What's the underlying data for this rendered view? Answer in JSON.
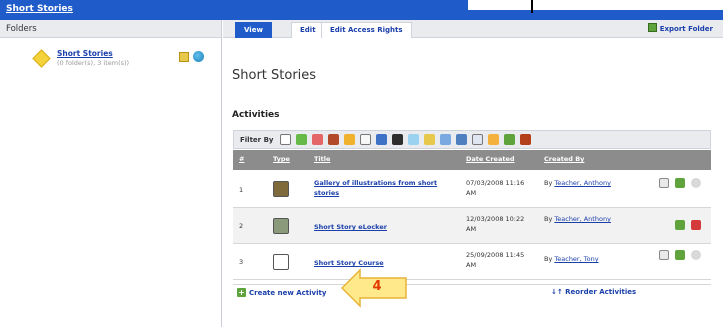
{
  "app": {
    "title": "Short Stories"
  },
  "left": {
    "header": "Folders",
    "folder": {
      "name": "Short Stories",
      "meta": "(0 folder(s), 3 item(s))"
    }
  },
  "tabs": [
    {
      "label": "View"
    },
    {
      "label": "Edit"
    },
    {
      "label": "Edit Access Rights"
    }
  ],
  "export_label": "Export Folder",
  "main": {
    "page_title": "Short Stories",
    "section_title": "Activities",
    "filter_label": "Filter By"
  },
  "table": {
    "headers": [
      "#",
      "Type",
      "Title",
      "Date Created",
      "Created By"
    ],
    "rows": [
      {
        "num": "1",
        "title": "Gallery of illustrations from short stories",
        "date": "07/03/2008 11:16 AM",
        "by_prefix": "By",
        "by_name": "Teacher, Anthony",
        "type_icon": "gallery-icon"
      },
      {
        "num": "2",
        "title": "Short Story eLocker",
        "date": "12/03/2008 10:22 AM",
        "by_prefix": "By",
        "by_name": "Teacher, Anthony",
        "type_icon": "elocker-icon"
      },
      {
        "num": "3",
        "title": "Short Story Course",
        "date": "25/09/2008 11:45 AM",
        "by_prefix": "By",
        "by_name": "Teacher, Tony",
        "type_icon": "course-icon"
      }
    ]
  },
  "footer": {
    "create_label": "Create new Activity",
    "reorder_label": "Reorder Activities"
  },
  "callout": {
    "number": "4"
  },
  "colors": {
    "brand": "#1f5bc9",
    "link": "#1a3faa",
    "header_gray": "#8c8c8c",
    "callout_fill": "#ffe98a",
    "callout_text": "#e23a00"
  }
}
